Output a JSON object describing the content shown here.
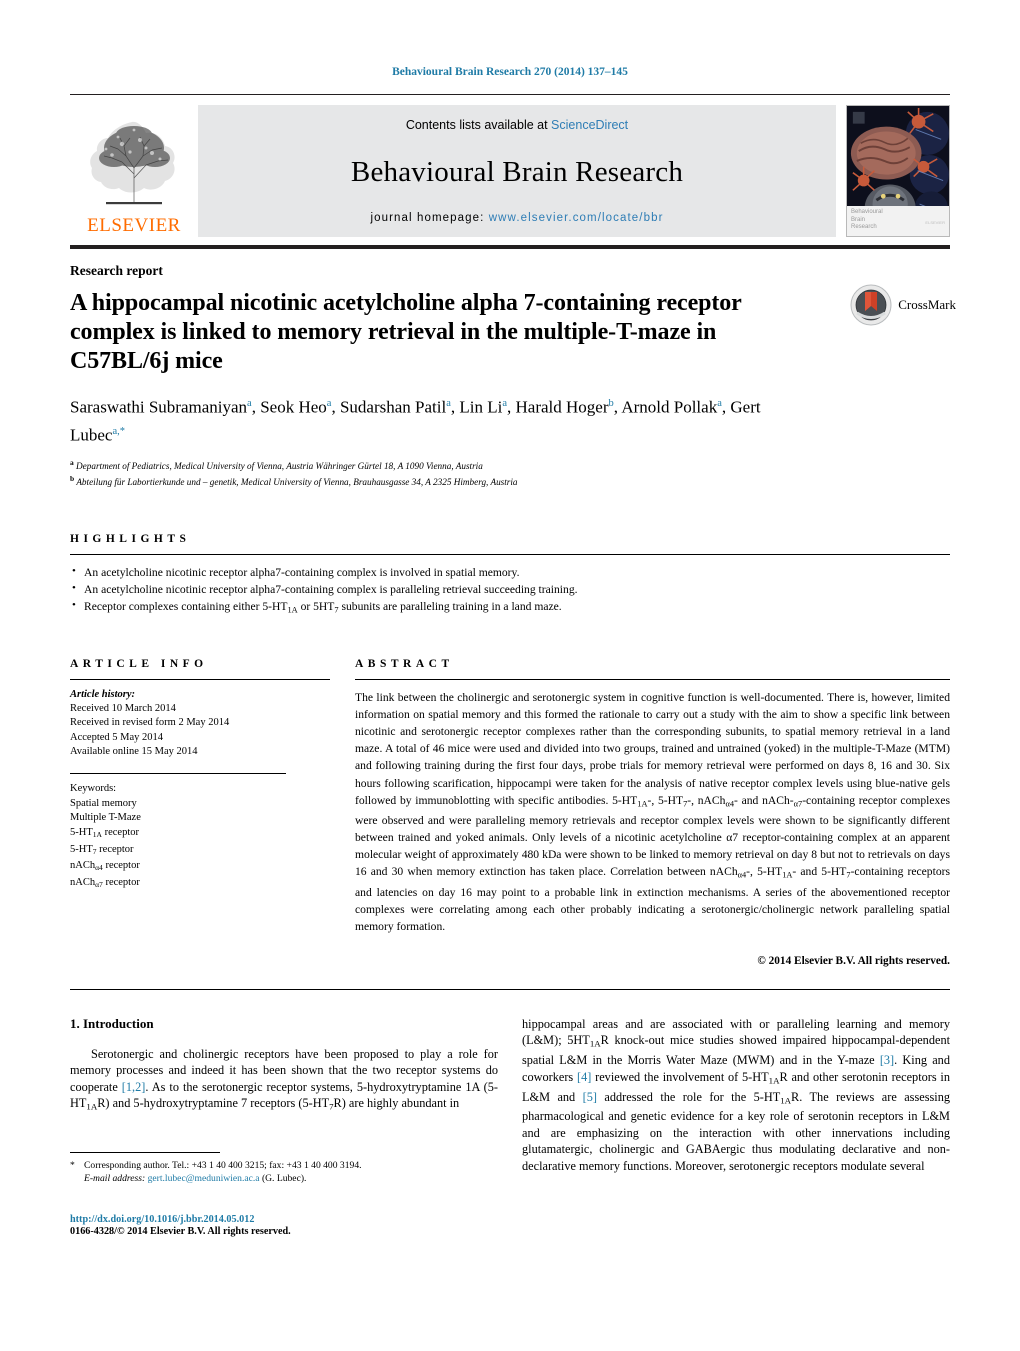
{
  "running_head": "Behavioural Brain Research 270 (2014) 137–145",
  "masthead": {
    "contents_prefix": "Contents lists available at ",
    "contents_link": "ScienceDirect",
    "journal_name": "Behavioural Brain Research",
    "homepage_prefix": "journal homepage: ",
    "homepage_url": "www.elsevier.com/locate/bbr",
    "publisher": "ELSEVIER",
    "cover_caption_line1": "Behavioural",
    "cover_caption_line2": "Brain",
    "cover_caption_line3": "Research",
    "cover_caption_publisher": "ELSEVIER"
  },
  "article": {
    "type": "Research report",
    "title": "A hippocampal nicotinic acetylcholine alpha 7-containing receptor complex is linked to memory retrieval in the multiple-T-maze in C57BL/6j mice",
    "crossmark_label": "CrossMark",
    "authors_html": "Saraswathi Subramaniyan<sup>a</sup>, Seok Heo<sup>a</sup>, Sudarshan Patil<sup>a</sup>, Lin Li<sup>a</sup>, Harald Hoger<sup>b</sup>, Arnold Pollak<sup>a</sup>, Gert Lubec<sup>a,*</sup>",
    "affiliation_a": "Department of Pediatrics, Medical University of Vienna, Austria Währinger Gürtel 18, A 1090 Vienna, Austria",
    "affiliation_b": "Abteilung für Labortierkunde und – genetik, Medical University of Vienna, Brauhausgasse 34, A 2325 Himberg, Austria"
  },
  "highlights": {
    "heading": "HIGHLIGHTS",
    "items": [
      "An acetylcholine nicotinic receptor alpha7-containing complex is involved in spatial memory.",
      "An acetylcholine nicotinic receptor alpha7-containing complex is paralleling retrieval succeeding training.",
      "Receptor complexes containing either 5-HT1A or 5HT7 subunits are paralleling training in a land maze."
    ]
  },
  "article_info": {
    "heading": "ARTICLE INFO",
    "history_label": "Article history:",
    "history": [
      "Received 10 March 2014",
      "Received in revised form 2 May 2014",
      "Accepted 5 May 2014",
      "Available online 15 May 2014"
    ],
    "keywords_label": "Keywords:",
    "keywords": [
      "Spatial memory",
      "Multiple T-Maze",
      "5-HT1A receptor",
      "5-HT7 receptor",
      "nAChα4 receptor",
      "nAChα7 receptor"
    ]
  },
  "abstract": {
    "heading": "ABSTRACT",
    "text": "The link between the cholinergic and serotonergic system in cognitive function is well-documented. There is, however, limited information on spatial memory and this formed the rationale to carry out a study with the aim to show a specific link between nicotinic and serotonergic receptor complexes rather than the corresponding subunits, to spatial memory retrieval in a land maze. A total of 46 mice were used and divided into two groups, trained and untrained (yoked) in the multiple-T-Maze (MTM) and following training during the first four days, probe trials for memory retrieval were performed on days 8, 16 and 30. Six hours following scarification, hippocampi were taken for the analysis of native receptor complex levels using blue-native gels followed by immunoblotting with specific antibodies. 5-HT1A-, 5-HT7-, nAChα4- and nACh-α7-containing receptor complexes were observed and were paralleling memory retrievals and receptor complex levels were shown to be significantly different between trained and yoked animals. Only levels of a nicotinic acetylcholine α7 receptor-containing complex at an apparent molecular weight of approximately 480 kDa were shown to be linked to memory retrieval on day 8 but not to retrievals on days 16 and 30 when memory extinction has taken place. Correlation between nAChα4-, 5-HT1A- and 5-HT7-containing receptors and latencies on day 16 may point to a probable link in extinction mechanisms. A series of the abovementioned receptor complexes were correlating among each other probably indicating a serotonergic/cholinergic network paralleling spatial memory formation.",
    "copyright": "© 2014 Elsevier B.V. All rights reserved."
  },
  "introduction": {
    "heading": "1.  Introduction",
    "left_paragraph": "Serotonergic and cholinergic receptors have been proposed to play a role for memory processes and indeed it has been shown that the two receptor systems do cooperate [1,2]. As to the serotonergic receptor systems, 5-hydroxytryptamine 1A (5-HT1AR) and 5-hydroxytryptamine 7 receptors (5-HT7R) are highly abundant in",
    "right_paragraph": "hippocampal areas and are associated with or paralleling learning and memory (L&M); 5HT1AR knock-out mice studies showed impaired hippocampal-dependent spatial L&M in the Morris Water Maze (MWM) and in the Y-maze [3]. King and coworkers [4] reviewed the involvement of 5-HT1AR and other serotonin receptors in L&M and [5] addressed the role for the 5-HT1AR. The reviews are assessing pharmacological and genetic evidence for a key role of serotonin receptors in L&M and are emphasizing on the interaction with other innervations including glutamatergic, cholinergic and GABAergic thus modulating declarative and non-declarative memory functions. Moreover, serotonergic receptors modulate several"
  },
  "footnote": {
    "star": "*",
    "corresponding": "Corresponding author. Tel.: +43 1 40 400 3215; fax: +43 1 40 400 3194.",
    "email_label": "E-mail address:",
    "email": "gert.lubec@meduniwien.ac.a",
    "email_owner": "(G. Lubec)."
  },
  "footer": {
    "doi": "http://dx.doi.org/10.1016/j.bbr.2014.05.012",
    "issn": "0166-4328/© 2014 Elsevier B.V. All rights reserved."
  },
  "colors": {
    "link": "#1f7ba6",
    "elsevier_orange": "#ff6c00",
    "masthead_bg": "#e6e7e8"
  }
}
